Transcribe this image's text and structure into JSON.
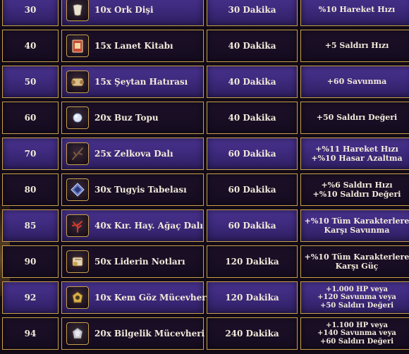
{
  "rows": [
    {
      "level": "30",
      "item": "10x Ork Dişi",
      "icon": "tooth-icon",
      "time": "30 Dakika",
      "reward": [
        "%10 Hareket Hızı"
      ]
    },
    {
      "level": "40",
      "item": "15x Lanet Kitabı",
      "icon": "book-icon",
      "time": "40 Dakika",
      "reward": [
        "+5 Saldırı Hızı"
      ]
    },
    {
      "level": "50",
      "item": "15x Şeytan Hatırası",
      "icon": "scroll-icon",
      "time": "40 Dakika",
      "reward": [
        "+60 Savunma"
      ]
    },
    {
      "level": "60",
      "item": "20x Buz Topu",
      "icon": "ice-ball-icon",
      "time": "40 Dakika",
      "reward": [
        "+50 Saldırı Değeri"
      ]
    },
    {
      "level": "70",
      "item": "25x Zelkova Dalı",
      "icon": "branch-icon",
      "time": "60 Dakika",
      "reward": [
        "+%11 Hareket Hızı",
        "+%10 Hasar Azaltma"
      ]
    },
    {
      "level": "80",
      "item": "30x Tugyis Tabelası",
      "icon": "tablet-icon",
      "time": "60 Dakika",
      "reward": [
        "+%6 Saldırı Hızı",
        "+%10 Saldırı Değeri"
      ]
    },
    {
      "level": "85",
      "item": "40x Kır. Hay. Ağaç Dalı",
      "icon": "red-branch-icon",
      "time": "60 Dakika",
      "reward": [
        "+%10 Tüm Karakterlere",
        "Karşı Savunma"
      ]
    },
    {
      "level": "90",
      "item": "50x Liderin Notları",
      "icon": "notes-icon",
      "time": "120 Dakika",
      "reward": [
        "+%10 Tüm Karakterlere",
        "Karşı Güç"
      ]
    },
    {
      "level": "92",
      "item": "10x Kem Göz Mücevheri",
      "icon": "gold-gem-icon",
      "time": "120 Dakika",
      "reward": [
        "+1.000 HP veya",
        "+120 Savunma veya",
        "+50 Saldırı Değeri"
      ]
    },
    {
      "level": "94",
      "item": "20x Bilgelik Mücevheri",
      "icon": "silver-gem-icon",
      "time": "240 Dakika",
      "reward": [
        "+1.100 HP veya",
        "+140 Savunma veya",
        "+60 Saldırı Değeri"
      ]
    }
  ]
}
